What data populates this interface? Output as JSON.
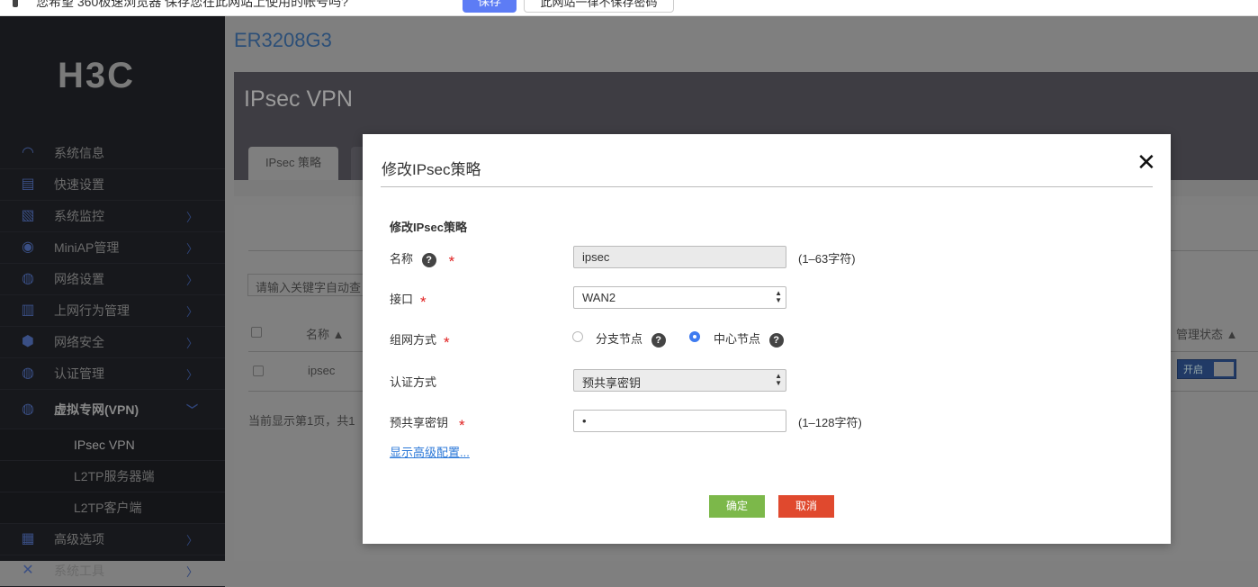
{
  "browser_bar": {
    "message": "您希望 360极速浏览器 保存您在此网站上使用的帐号吗?",
    "save": "保存",
    "never": "此网站一律不保存密码"
  },
  "logo": "H3C",
  "sidebar": {
    "items": [
      {
        "label": "系统信息",
        "icon": "dashboard-icon",
        "chevron": false
      },
      {
        "label": "快速设置",
        "icon": "quick-setup-icon",
        "chevron": false
      },
      {
        "label": "系统监控",
        "icon": "monitor-icon",
        "chevron": true
      },
      {
        "label": "MiniAP管理",
        "icon": "wifi-icon",
        "chevron": true
      },
      {
        "label": "网络设置",
        "icon": "globe-icon",
        "chevron": true
      },
      {
        "label": "上网行为管理",
        "icon": "document-icon",
        "chevron": true
      },
      {
        "label": "网络安全",
        "icon": "shield-icon",
        "chevron": true
      },
      {
        "label": "认证管理",
        "icon": "globe-user-icon",
        "chevron": true
      }
    ],
    "vpn": {
      "label": "虚拟专网(VPN)",
      "icon": "globe-lock-icon",
      "subitems": [
        "IPsec VPN",
        "L2TP服务器端",
        "L2TP客户端"
      ]
    },
    "after": [
      {
        "label": "高级选项",
        "icon": "grid-search-icon"
      },
      {
        "label": "系统工具",
        "icon": "tools-icon"
      }
    ]
  },
  "device": "ER3208G3",
  "panel": {
    "title": "IPsec VPN",
    "tab": "IPsec 策略",
    "search_placeholder": "请输入关键字自动查",
    "col_name": "名称 ▲",
    "col_status": "管理状态 ▲",
    "row_name": "ipsec",
    "row_status": "开启",
    "pager": "当前显示第1页，共1"
  },
  "dialog": {
    "title": "修改IPsec策略",
    "section": "修改IPsec策略",
    "name_label": "名称",
    "name_value": "ipsec",
    "name_hint": "(1–63字符)",
    "iface_label": "接口",
    "iface_value": "WAN2",
    "mode_label": "组网方式",
    "mode_options": [
      "分支节点",
      "中心节点"
    ],
    "mode_selected": "中心节点",
    "auth_label": "认证方式",
    "auth_value": "预共享密钥",
    "psk_label": "预共享密钥",
    "psk_value": "•",
    "psk_hint": "(1–128字符)",
    "advanced": "显示高级配置...",
    "ok": "确定",
    "cancel": "取消"
  }
}
